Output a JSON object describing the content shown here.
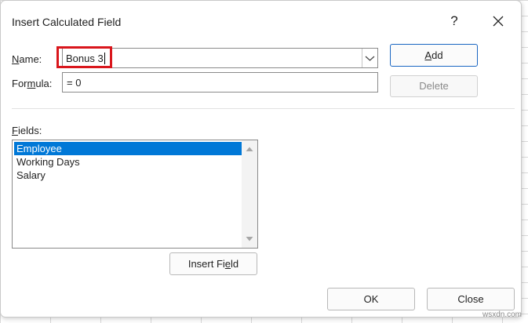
{
  "dialog": {
    "title": "Insert Calculated Field",
    "help_glyph": "?"
  },
  "form": {
    "name_label_accel": "N",
    "name_label_rest": "ame:",
    "name_value": "Bonus 3",
    "formula_label_pre": "For",
    "formula_label_accel": "m",
    "formula_label_post": "ula:",
    "formula_value": "= 0"
  },
  "buttons": {
    "add_accel": "A",
    "add_rest": "dd",
    "delete_label": "Delete",
    "insert_pre": "Insert Fi",
    "insert_accel": "e",
    "insert_post": "ld",
    "ok_label": "OK",
    "close_label": "Close"
  },
  "fields": {
    "label_accel": "F",
    "label_rest": "ields:",
    "items": [
      "Employee",
      "Working Days",
      "Salary"
    ],
    "selected_index": 0
  },
  "colors": {
    "selection": "#0078d7",
    "highlight_box": "#d9161c",
    "default_button_border": "#1a66c2"
  },
  "watermark": "wsxdn.com"
}
